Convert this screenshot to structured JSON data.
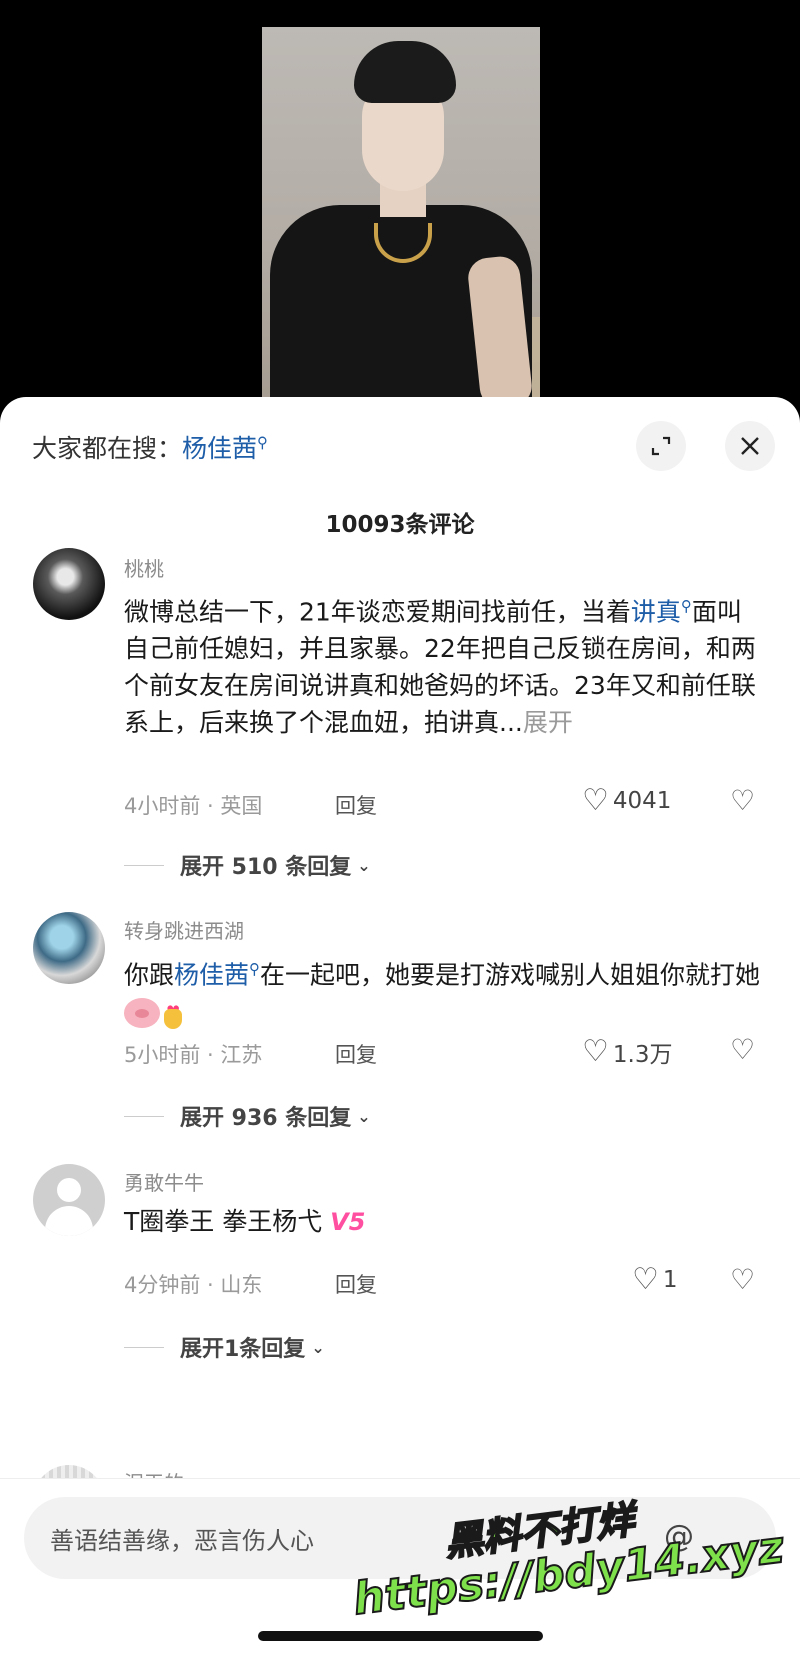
{
  "video": {
    "description_icon": "video-frame"
  },
  "sheet": {
    "search_prefix": "大家都在搜：",
    "search_term": "杨佳茜",
    "comment_count": "10093条评论"
  },
  "comments": [
    {
      "username": "桃桃",
      "text_part1": "微博总结一下，21年谈恋爱期间找前任，当着",
      "link": "讲真",
      "text_part2": "面叫自己前任媳妇，并且家暴。22年把自己反锁在房间，和两个前女友在房间说讲真和她爸妈的坏话。23年又和前任联系上，后来换了个混血妞，拍讲真...",
      "more": "展开",
      "meta": "4小时前 · 英国",
      "reply": "回复",
      "likes": "4041",
      "expand": "展开 510 条回复"
    },
    {
      "username": "转身跳进西湖",
      "text_part1": "你跟",
      "link": "杨佳茜",
      "text_part2": "在一起吧，她要是打游戏喊别人姐姐你就打她",
      "meta": "5小时前 · 江苏",
      "reply": "回复",
      "likes": "1.3万",
      "expand": "展开 936 条回复"
    },
    {
      "username": "勇敢牛牛",
      "text": "T圈拳王 拳王杨弋",
      "badge": "V5",
      "meta": "4分钟前 · 山东",
      "reply": "回复",
      "likes": "1",
      "expand": "展开1条回复"
    },
    {
      "username": "泥王的"
    }
  ],
  "input": {
    "placeholder": "善语结善缘，恶言伤人心"
  },
  "watermark": {
    "line1": "黑料不打烊",
    "line2": "https://bdy14.xyz"
  }
}
